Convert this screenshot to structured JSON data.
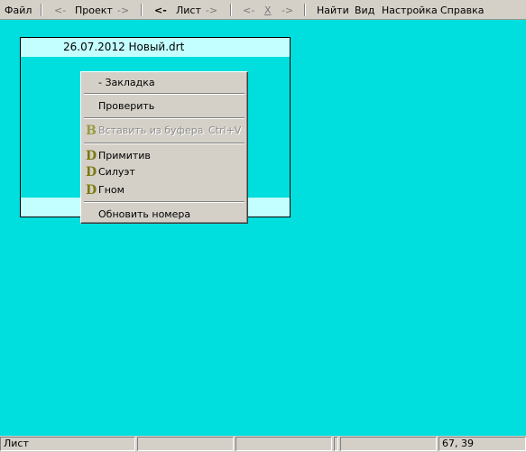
{
  "menubar": {
    "file": "Файл",
    "proj_prev": "<-",
    "proj": "Проект",
    "proj_next": "->",
    "sheet_prev": "<-",
    "sheet": "Лист",
    "sheet_next": "->",
    "x_prev": "<-",
    "x": "X",
    "x_next": "->",
    "find": "Найти",
    "view": "Вид",
    "settings": "Настройка",
    "help": "Справка"
  },
  "document": {
    "title": "26.07.2012  Новый.drt"
  },
  "context_menu": {
    "bookmark": "- Закладка",
    "check": "Проверить",
    "paste": {
      "glyph": "B",
      "label": "Вставить из буфера",
      "shortcut": "Ctrl+V",
      "disabled": true
    },
    "primitive": {
      "glyph": "D",
      "label": "Примитив"
    },
    "silhouette": {
      "glyph": "D",
      "label": "Силуэт"
    },
    "gnome": {
      "glyph": "D",
      "label": "Гном"
    },
    "renumber": "Обновить номера"
  },
  "statusbar": {
    "mode": "Лист",
    "coords": "67, 39"
  },
  "colors": {
    "workspace": "#00dede",
    "doc_band": "#c4ffff",
    "chrome": "#d4d0c8",
    "glyph": "#7c7a10"
  }
}
